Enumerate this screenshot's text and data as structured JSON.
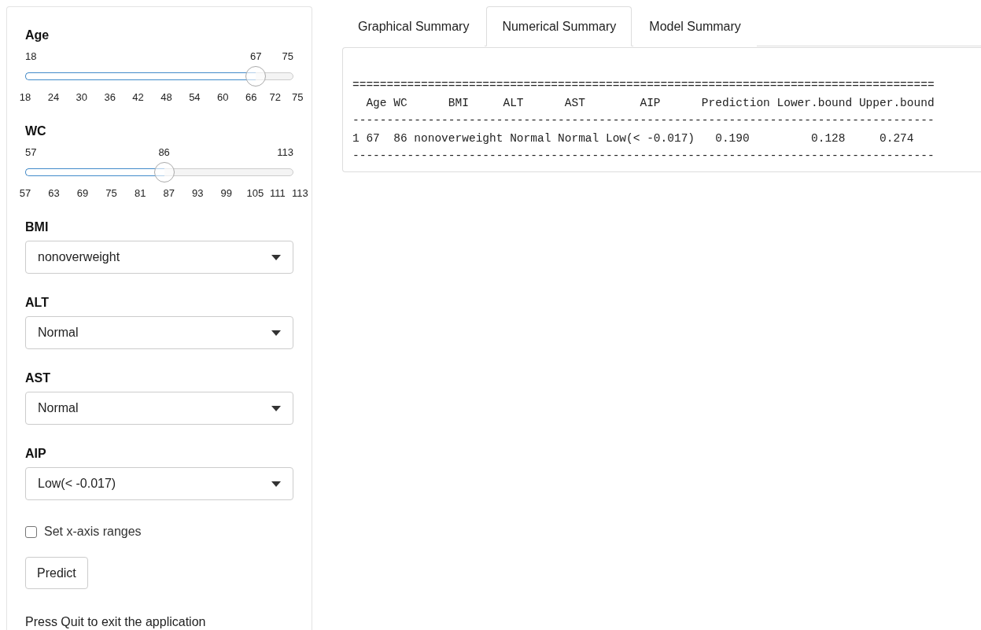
{
  "sidebar": {
    "sliders": [
      {
        "label": "Age",
        "min": "18",
        "max": "75",
        "value": "67",
        "level": 0.86,
        "ticks": [
          "18",
          "24",
          "30",
          "36",
          "42",
          "48",
          "54",
          "60",
          "66",
          "72",
          "75"
        ]
      },
      {
        "label": "WC",
        "min": "57",
        "max": "113",
        "value": "86",
        "level": 0.518,
        "ticks": [
          "57",
          "63",
          "69",
          "75",
          "81",
          "87",
          "93",
          "99",
          "105",
          "111",
          "113"
        ]
      }
    ],
    "selects": [
      {
        "label": "BMI",
        "value": "nonoverweight"
      },
      {
        "label": "ALT",
        "value": "Normal"
      },
      {
        "label": "AST",
        "value": "Normal"
      },
      {
        "label": "AIP",
        "value": "Low(< -0.017)"
      }
    ],
    "checkbox": {
      "label": "Set x-axis ranges",
      "checked": false
    },
    "button": "Predict",
    "note": "Press Quit to exit the application"
  },
  "tabs": [
    {
      "label": "Graphical Summary",
      "selected": false
    },
    {
      "label": "Numerical Summary",
      "selected": true
    },
    {
      "label": "Model Summary",
      "selected": false
    }
  ],
  "output": {
    "lines": [
      "=====================================================================================",
      "  Age WC      BMI     ALT      AST        AIP      Prediction Lower.bound Upper.bound",
      "-------------------------------------------------------------------------------------",
      "1 67  86 nonoverweight Normal Normal Low(< -0.017)   0.190         0.128     0.274",
      "-------------------------------------------------------------------------------------"
    ]
  }
}
